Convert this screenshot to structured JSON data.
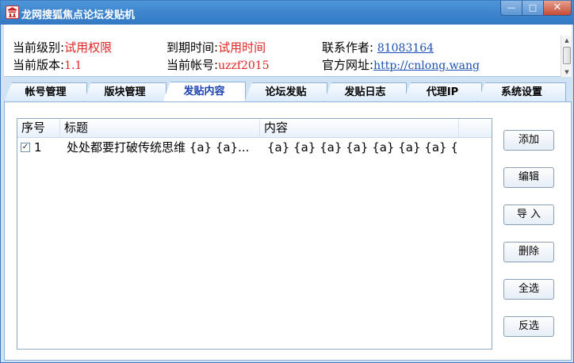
{
  "window": {
    "title": "龙网搜狐焦点论坛发贴机",
    "controls": {
      "minimize": "—",
      "maximize": "□",
      "close": "✕"
    }
  },
  "info": {
    "level_label": "当前级别:",
    "level_value": "试用权限",
    "expiry_label": "到期时间:",
    "expiry_value": "试用时间",
    "contact_label": "联系作者: ",
    "contact_value": "81083164",
    "version_label": "当前版本:",
    "version_value": "1.1",
    "account_label": "当前帐号:",
    "account_value": "uzzf2015",
    "site_label": "官方网址:",
    "site_value": "http://cnlong.wang"
  },
  "tabs": [
    {
      "label": "帐号管理",
      "active": false
    },
    {
      "label": "版块管理",
      "active": false
    },
    {
      "label": "发贴内容",
      "active": true
    },
    {
      "label": "论坛发贴",
      "active": false
    },
    {
      "label": "发贴日志",
      "active": false
    },
    {
      "label": "代理IP",
      "active": false
    },
    {
      "label": "系统设置",
      "active": false
    }
  ],
  "table": {
    "columns": [
      "序号",
      "标题",
      "内容"
    ],
    "rows": [
      {
        "checked": true,
        "index": "1",
        "title": "处处都要打破传统思维 {a} {a}...",
        "content": "{a} {a} {a} {a} {a} {a} {a} {a} {a..."
      }
    ]
  },
  "buttons": {
    "add": "添加",
    "edit": "编辑",
    "import": "导 入",
    "delete": "删除",
    "select_all": "全选",
    "invert": "反选"
  },
  "colors": {
    "titlebar": "#3b82cc",
    "highlight_red": "#e02424",
    "link_blue": "#1b4fb5",
    "active_tab_text": "#1a3fb0"
  }
}
